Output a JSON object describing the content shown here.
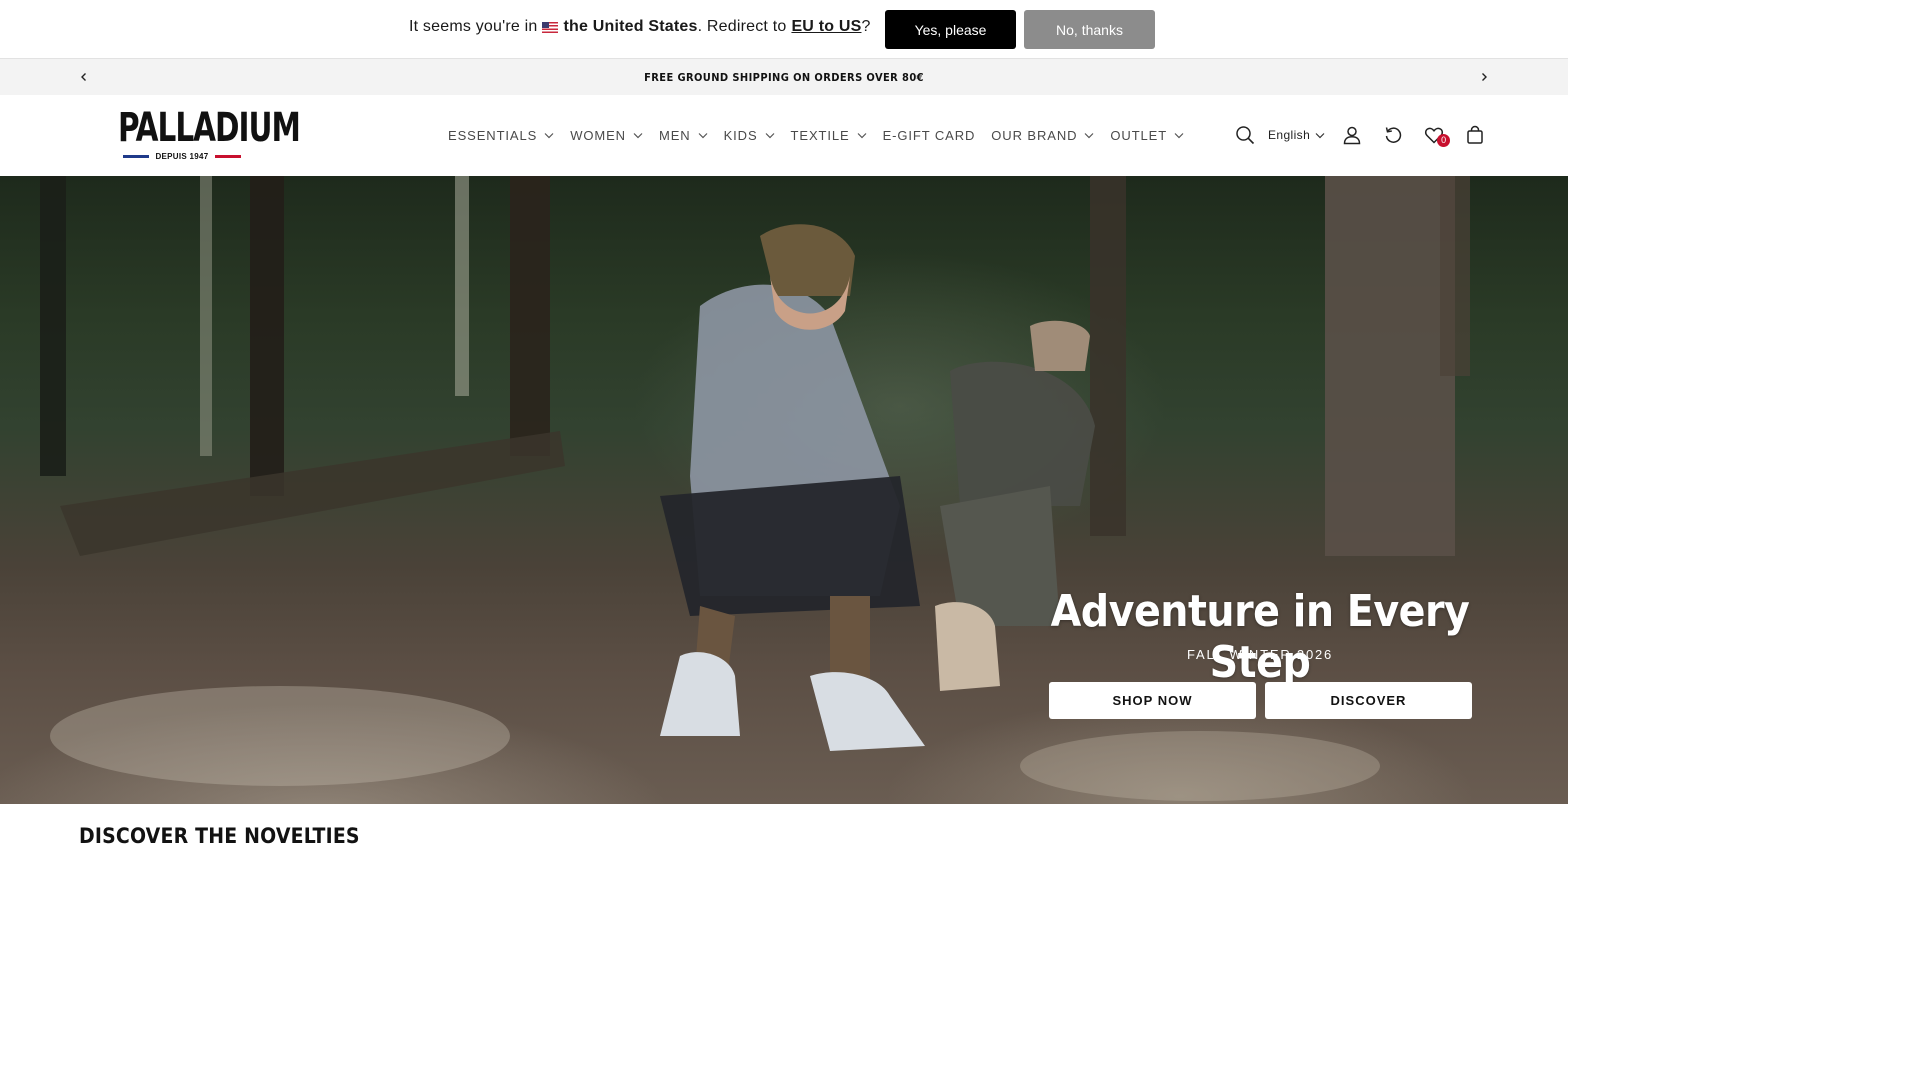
{
  "geo_bar": {
    "prefix": "It seems you're in",
    "country": "the United States",
    "middle": ". Redirect to",
    "link": "EU to US",
    "suffix": "?",
    "yes_label": "Yes, please",
    "no_label": "No, thanks",
    "flag_icon": "us-flag-icon"
  },
  "announcement": {
    "text": "FREE GROUND SHIPPING ON ORDERS OVER 80€",
    "prev_icon": "chevron-left-icon",
    "next_icon": "chevron-right-icon"
  },
  "header": {
    "logo": {
      "word": "PALLADIUM",
      "tagline": "DEPUIS 1947"
    },
    "nav": [
      {
        "label": "ESSENTIALS",
        "has_dropdown": true
      },
      {
        "label": "WOMEN",
        "has_dropdown": true
      },
      {
        "label": "MEN",
        "has_dropdown": true
      },
      {
        "label": "KIDS",
        "has_dropdown": true
      },
      {
        "label": "TEXTILE",
        "has_dropdown": true
      },
      {
        "label": "E-GIFT CARD",
        "has_dropdown": false
      },
      {
        "label": "OUR BRAND",
        "has_dropdown": true
      },
      {
        "label": "OUTLET",
        "has_dropdown": true
      }
    ],
    "language": "English",
    "wishlist_count": "0",
    "icons": [
      "search-icon",
      "account-icon",
      "returns-icon",
      "wishlist-icon",
      "cart-icon"
    ]
  },
  "hero": {
    "title": "Adventure in Every Step",
    "subtitle": "FALL WINTER 2026",
    "shop_label": "SHOP NOW",
    "discover_label": "DISCOVER"
  },
  "sections": {
    "novelties_title": "DISCOVER THE NOVELTIES"
  },
  "colors": {
    "brand_blue": "#1f3a8a",
    "brand_red": "#c8102e",
    "primary_button": "#000000",
    "secondary_button": "#8c8c8c",
    "announcement_bg": "#f3f3f3"
  }
}
